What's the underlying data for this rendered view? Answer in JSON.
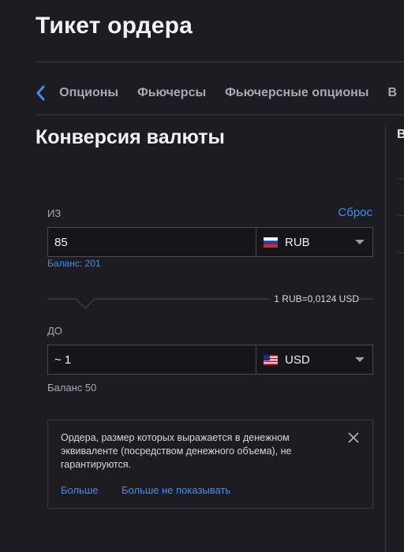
{
  "page": {
    "title": "Тикет ордера"
  },
  "tabs": {
    "items": [
      {
        "label": "Опционы"
      },
      {
        "label": "Фьючерсы"
      },
      {
        "label": "Фьючерсные опционы"
      },
      {
        "label": "В"
      }
    ]
  },
  "section": {
    "title": "Конверсия валюты"
  },
  "right_column": {
    "letter": "В"
  },
  "converter": {
    "from": {
      "label": "ИЗ",
      "reset_label": "Сброс",
      "amount": "85",
      "currency": "RUB",
      "flag": "russia-flag-icon",
      "balance": "Баланс: 201"
    },
    "rate": "1 RUB=0,0124 USD",
    "to": {
      "label": "ДО",
      "amount": "~ 1",
      "currency": "USD",
      "flag": "usa-flag-icon",
      "balance": "Баланс 50"
    }
  },
  "notice": {
    "text": "Ордера, размер которых выражается в денежном эквиваленте (посредством денежного объема), не гарантируются.",
    "more_label": "Больше",
    "dont_show_label": "Больше не показывать"
  },
  "colors": {
    "background": "#1c1c22",
    "accent": "#3d8ff0",
    "border": "#4a4a52",
    "muted_text": "#a9a9b3"
  }
}
